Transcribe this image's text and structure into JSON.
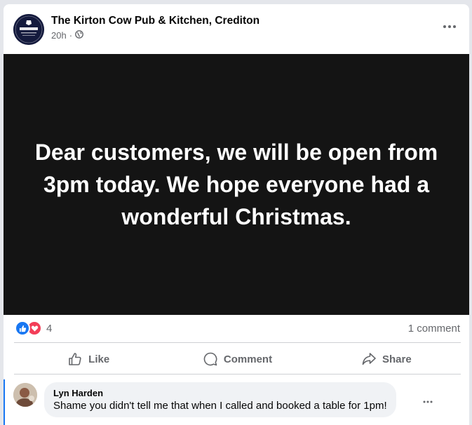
{
  "post": {
    "page_name": "The Kirton Cow Pub & Kitchen, Crediton",
    "time": "20h",
    "separator": "·",
    "audience_icon": "globe-icon",
    "avatar_text": "KIRTON COW",
    "image_text": "Dear customers, we will be open from 3pm today. We hope everyone had a wonderful Christmas."
  },
  "stats": {
    "reaction_icons": [
      "like-icon",
      "love-icon"
    ],
    "reaction_count": "4",
    "comment_count": "1 comment"
  },
  "actions": {
    "like_label": "Like",
    "comment_label": "Comment",
    "share_label": "Share"
  },
  "comment": {
    "author": "Lyn Harden",
    "text": "Shame you didn't tell me that when I called and booked a table for 1pm!"
  },
  "colors": {
    "accent": "#1877f2",
    "love": "#f33e58",
    "secondary_text": "#65676b",
    "image_bg": "#141414"
  }
}
